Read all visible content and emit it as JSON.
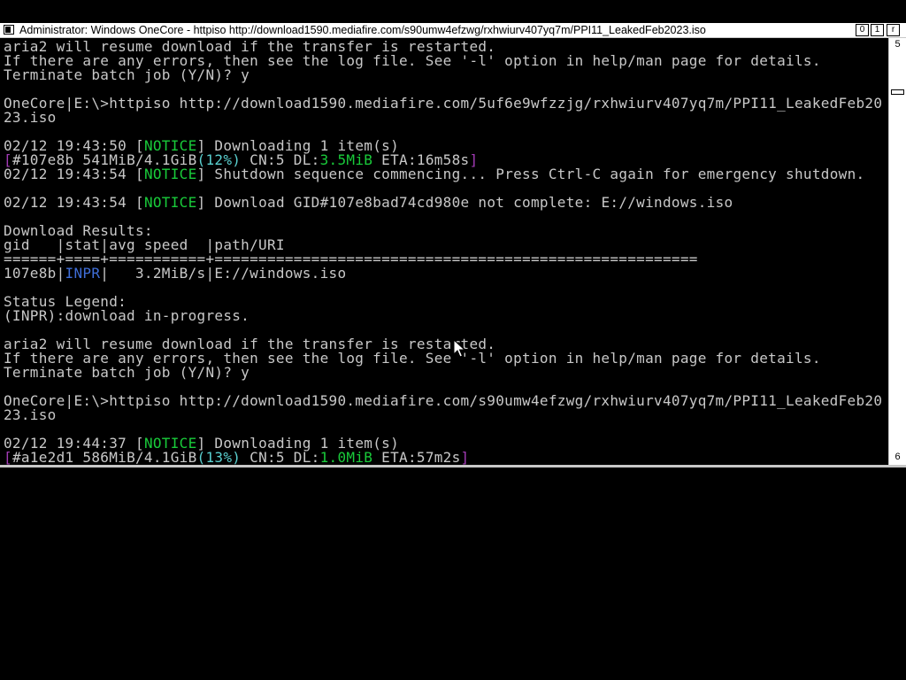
{
  "window": {
    "title": "Administrator:  Windows OneCore - httpiso  http://download1590.mediafire.com/s90umw4efzwg/rxhwiurv407yq7m/PPI11_LeakedFeb2023.iso",
    "buttons": {
      "minimize": "0",
      "maximize": "1",
      "close": "r"
    }
  },
  "scrollbar": {
    "up_label": "5",
    "down_label": "6"
  },
  "console": {
    "l01": "aria2 will resume download if the transfer is restarted.",
    "l02": "If there are any errors, then see the log file. See '-l' option in help/man page for details.",
    "l03": "Terminate batch job (Y/N)? y",
    "l05": "OneCore|E:\\>httpiso http://download1590.mediafire.com/5uf6e9wfzzjg/rxhwiurv407yq7m/PPI11_LeakedFeb20",
    "l06": "23.iso",
    "l08_time": "02/12 19:43:50 [",
    "l08_tag": "NOTICE",
    "l08_msg": "] Downloading 1 item(s)",
    "l09_open": "[",
    "l09_a": "#107e8b 541MiB/4.1GiB",
    "l09_pct": "(12%)",
    "l09_b": " CN:5 DL:",
    "l09_dl": "3.5MiB",
    "l09_eta": " ETA:16m58s",
    "l09_close": "]",
    "l10_time": "02/12 19:43:54 [",
    "l10_tag": "NOTICE",
    "l10_msg": "] Shutdown sequence commencing... Press Ctrl-C again for emergency shutdown.",
    "l12_time": "02/12 19:43:54 [",
    "l12_tag": "NOTICE",
    "l12_msg": "] Download GID#107e8bad74cd980e not complete: E://windows.iso",
    "l14": "Download Results:",
    "l15": "gid   |stat|avg speed  |path/URI",
    "l16": "======+====+===========+=======================================================",
    "l17_a": "107e8b|",
    "l17_stat": "INPR",
    "l17_b": "|   3.2MiB/s|E://windows.iso",
    "l19": "Status Legend:",
    "l20": "(INPR):download in-progress.",
    "l22": "aria2 will resume download if the transfer is restarted.",
    "l23": "If there are any errors, then see the log file. See '-l' option in help/man page for details.",
    "l24": "Terminate batch job (Y/N)? y",
    "l26": "OneCore|E:\\>httpiso http://download1590.mediafire.com/s90umw4efzwg/rxhwiurv407yq7m/PPI11_LeakedFeb20",
    "l27": "23.iso",
    "l29_time": "02/12 19:44:37 [",
    "l29_tag": "NOTICE",
    "l29_msg": "] Downloading 1 item(s)",
    "l30_open": "[",
    "l30_a": "#a1e2d1 586MiB/4.1GiB",
    "l30_pct": "(13%)",
    "l30_b": " CN:5 DL:",
    "l30_dl": "1.0MiB",
    "l30_eta": " ETA:57m2s",
    "l30_close": "]"
  },
  "colors": {
    "notice": "#19cb3a",
    "bracket": "#a23bb5",
    "status_inpr": "#3f6ed8",
    "speed": "#19cb3a",
    "text": "#c8c8c8",
    "background": "#000000"
  }
}
